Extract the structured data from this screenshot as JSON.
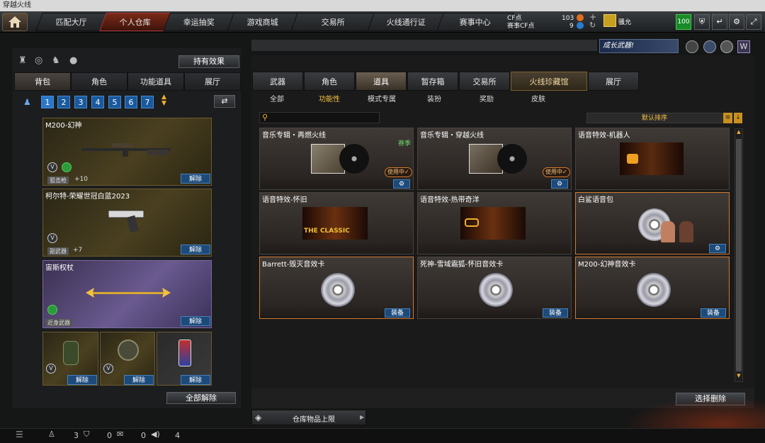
{
  "window_title": "穿越火线",
  "nav": {
    "tabs": [
      "匹配大厅",
      "个人仓库",
      "幸运抽奖",
      "游戏商城",
      "交易所",
      "火线通行证",
      "赛事中心"
    ],
    "active": "个人仓库",
    "cf_label": "CF点",
    "cf_value": "103",
    "event_cf_label": "赛事CF点",
    "event_cf_value": "9",
    "username": "骚允",
    "level": "100"
  },
  "banner_text": "成长武器!",
  "left": {
    "effect_button": "持有效果",
    "tabs": [
      "背包",
      "角色",
      "功能道具",
      "展厅"
    ],
    "pages": [
      "1",
      "2",
      "3",
      "4",
      "5",
      "6",
      "7"
    ],
    "slots": [
      {
        "name": "M200-幻神",
        "category": "狙击枪",
        "extra": "+10",
        "button": "解除"
      },
      {
        "name": "柯尔特-荣耀世冠白蓝2023",
        "category": "副武器",
        "extra": "+7",
        "button": "解除"
      },
      {
        "name": "宙斯权杖",
        "category": "近身武器",
        "button": "解除"
      }
    ],
    "small_slots": [
      {
        "button": "解除"
      },
      {
        "button": "解除"
      },
      {
        "button": "解除"
      }
    ],
    "release_all": "全部解除"
  },
  "right": {
    "tabs": [
      "武器",
      "角色",
      "道具",
      "暂存箱",
      "交易所",
      "火线珍藏馆",
      "展厅"
    ],
    "active_tab": "道具",
    "subtabs": [
      "全部",
      "功能性",
      "模式专属",
      "装扮",
      "奖励",
      "皮肤"
    ],
    "active_subtab": "功能性",
    "sort_label": "默认排序",
    "cards": [
      {
        "title": "音乐专辑・再燃火线",
        "tag": "赛季",
        "status": "使用中✓"
      },
      {
        "title": "音乐专辑・穿越火线",
        "status": "使用中✓"
      },
      {
        "title": "语音特效-机器人"
      },
      {
        "title": "语音特效-怀旧",
        "art": "THE CLASSIC"
      },
      {
        "title": "语音特效-热带奇洋"
      },
      {
        "title": "白鲨语音包"
      },
      {
        "title": "Barrett-毁灭音效卡",
        "button": "装备"
      },
      {
        "title": "死神-雪域霜狐-怀旧音效卡",
        "button": "装备"
      },
      {
        "title": "M200-幻神音效卡",
        "button": "装备"
      }
    ],
    "delete_button": "选择删除",
    "capacity_label": "仓库物品上限"
  },
  "status_bar": {
    "players": "3",
    "shield": "0",
    "chat": "0",
    "volume": "4"
  },
  "colors": {
    "accent": "#1c4a7a",
    "highlight": "#f5c040",
    "selected": "#d07a30"
  }
}
